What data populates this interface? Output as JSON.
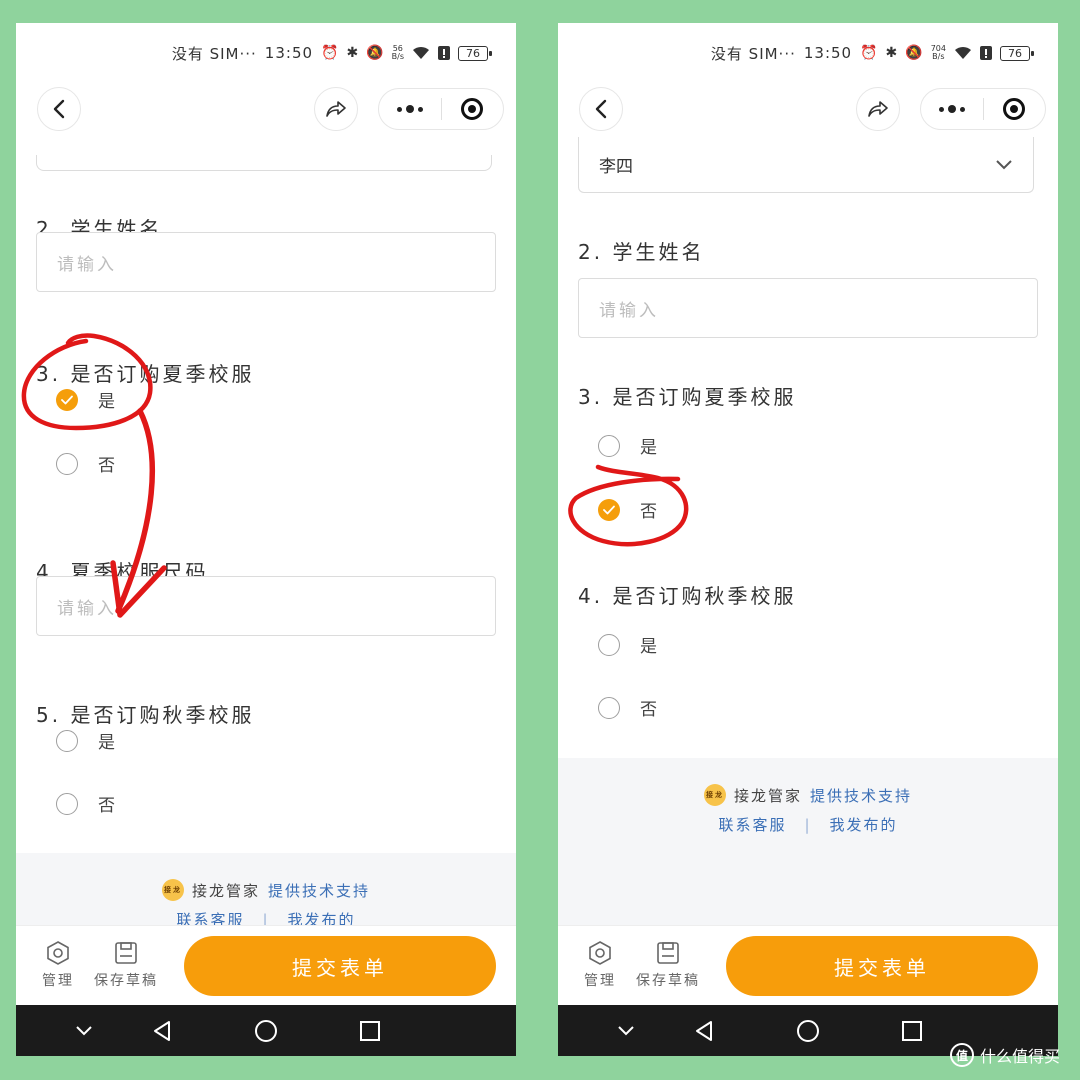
{
  "status_bar": {
    "sim": "没有 SIM···",
    "time": "13:50",
    "battery": "76",
    "speed_unit": "B/s",
    "left_speed": "56",
    "right_speed": "704"
  },
  "left": {
    "q2_title": "2. 学生姓名",
    "q2_placeholder": "请输入",
    "q3_title": "3. 是否订购夏季校服",
    "q3_options": [
      "是",
      "否"
    ],
    "q4_title": "4. 夏季校服尺码",
    "q4_placeholder": "请输入",
    "q5_title": "5. 是否订购秋季校服",
    "q5_options": [
      "是",
      "否"
    ],
    "q3_selected": "是"
  },
  "right": {
    "q1_value": "李四",
    "q2_title": "2. 学生姓名",
    "q2_placeholder": "请输入",
    "q3_title": "3. 是否订购夏季校服",
    "q3_options": [
      "是",
      "否"
    ],
    "q3_selected": "否",
    "q4_title": "4. 是否订购秋季校服",
    "q4_options": [
      "是",
      "否"
    ]
  },
  "footer": {
    "logo_text": "接龙",
    "brand": "接龙管家",
    "support": "提供技术支持",
    "contact": "联系客服",
    "separator": "|",
    "my_posts": "我发布的"
  },
  "actions": {
    "manage": "管理",
    "save_draft": "保存草稿",
    "submit": "提交表单"
  },
  "watermark": {
    "logo": "值",
    "text": "什么值得买"
  },
  "colors": {
    "background": "#8fd39d",
    "accent": "#f79d0b",
    "link": "#3b6fb6",
    "annotation": "#e01818"
  }
}
